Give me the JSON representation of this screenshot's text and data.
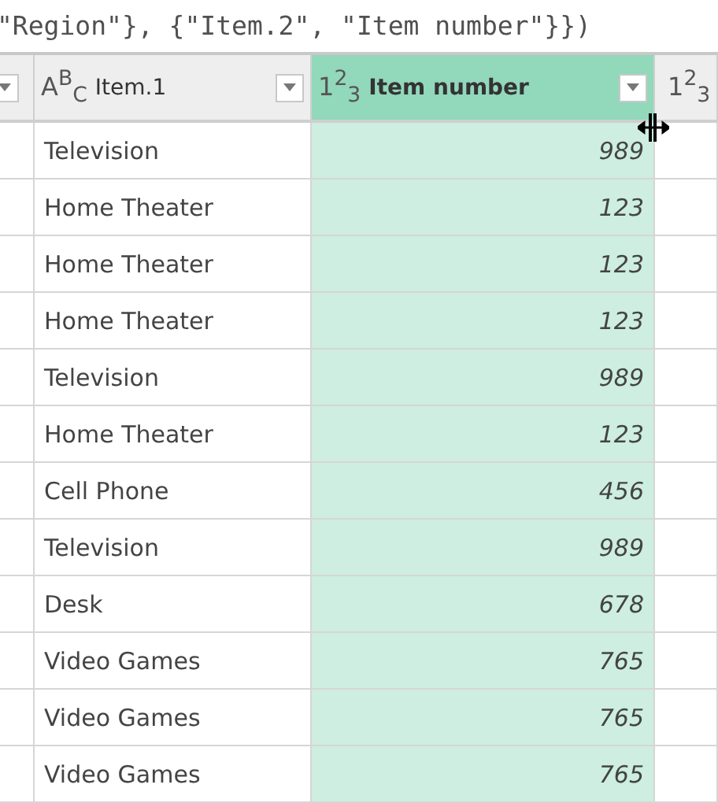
{
  "formula_bar": {
    "text": "\"Region\"}, {\"Item.2\", \"Item number\"}})"
  },
  "columns": [
    {
      "kind": "cut",
      "has_filter": true,
      "selected": false
    },
    {
      "kind": "text",
      "type_label": "A$^{B}$$_{C}$",
      "name": "Item.1",
      "has_filter": true,
      "selected": false
    },
    {
      "kind": "number",
      "type_label": "1$^{2}$$_{3}$",
      "name": "Item number",
      "has_filter": true,
      "selected": true
    },
    {
      "kind": "cut",
      "type_label": "1$^{2}$$_{3}$",
      "has_filter": false,
      "selected": false
    }
  ],
  "rows": [
    {
      "item": "Television",
      "number": "989"
    },
    {
      "item": "Home Theater",
      "number": "123"
    },
    {
      "item": "Home Theater",
      "number": "123"
    },
    {
      "item": "Home Theater",
      "number": "123"
    },
    {
      "item": "Television",
      "number": "989"
    },
    {
      "item": "Home Theater",
      "number": "123"
    },
    {
      "item": "Cell Phone",
      "number": "456"
    },
    {
      "item": "Television",
      "number": "989"
    },
    {
      "item": "Desk",
      "number": "678"
    },
    {
      "item": "Video Games",
      "number": "765"
    },
    {
      "item": "Video Games",
      "number": "765"
    },
    {
      "item": "Video Games",
      "number": "765"
    }
  ]
}
